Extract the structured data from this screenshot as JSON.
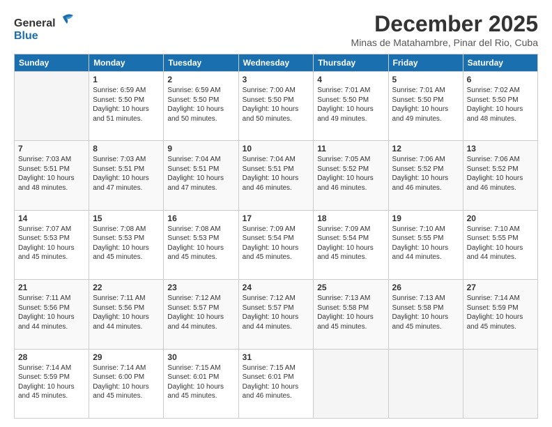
{
  "logo": {
    "line1": "General",
    "line2": "Blue"
  },
  "title": "December 2025",
  "subtitle": "Minas de Matahambre, Pinar del Rio, Cuba",
  "days_header": [
    "Sunday",
    "Monday",
    "Tuesday",
    "Wednesday",
    "Thursday",
    "Friday",
    "Saturday"
  ],
  "weeks": [
    [
      {
        "num": "",
        "info": ""
      },
      {
        "num": "1",
        "info": "Sunrise: 6:59 AM\nSunset: 5:50 PM\nDaylight: 10 hours\nand 51 minutes."
      },
      {
        "num": "2",
        "info": "Sunrise: 6:59 AM\nSunset: 5:50 PM\nDaylight: 10 hours\nand 50 minutes."
      },
      {
        "num": "3",
        "info": "Sunrise: 7:00 AM\nSunset: 5:50 PM\nDaylight: 10 hours\nand 50 minutes."
      },
      {
        "num": "4",
        "info": "Sunrise: 7:01 AM\nSunset: 5:50 PM\nDaylight: 10 hours\nand 49 minutes."
      },
      {
        "num": "5",
        "info": "Sunrise: 7:01 AM\nSunset: 5:50 PM\nDaylight: 10 hours\nand 49 minutes."
      },
      {
        "num": "6",
        "info": "Sunrise: 7:02 AM\nSunset: 5:50 PM\nDaylight: 10 hours\nand 48 minutes."
      }
    ],
    [
      {
        "num": "7",
        "info": "Sunrise: 7:03 AM\nSunset: 5:51 PM\nDaylight: 10 hours\nand 48 minutes."
      },
      {
        "num": "8",
        "info": "Sunrise: 7:03 AM\nSunset: 5:51 PM\nDaylight: 10 hours\nand 47 minutes."
      },
      {
        "num": "9",
        "info": "Sunrise: 7:04 AM\nSunset: 5:51 PM\nDaylight: 10 hours\nand 47 minutes."
      },
      {
        "num": "10",
        "info": "Sunrise: 7:04 AM\nSunset: 5:51 PM\nDaylight: 10 hours\nand 46 minutes."
      },
      {
        "num": "11",
        "info": "Sunrise: 7:05 AM\nSunset: 5:52 PM\nDaylight: 10 hours\nand 46 minutes."
      },
      {
        "num": "12",
        "info": "Sunrise: 7:06 AM\nSunset: 5:52 PM\nDaylight: 10 hours\nand 46 minutes."
      },
      {
        "num": "13",
        "info": "Sunrise: 7:06 AM\nSunset: 5:52 PM\nDaylight: 10 hours\nand 46 minutes."
      }
    ],
    [
      {
        "num": "14",
        "info": "Sunrise: 7:07 AM\nSunset: 5:53 PM\nDaylight: 10 hours\nand 45 minutes."
      },
      {
        "num": "15",
        "info": "Sunrise: 7:08 AM\nSunset: 5:53 PM\nDaylight: 10 hours\nand 45 minutes."
      },
      {
        "num": "16",
        "info": "Sunrise: 7:08 AM\nSunset: 5:53 PM\nDaylight: 10 hours\nand 45 minutes."
      },
      {
        "num": "17",
        "info": "Sunrise: 7:09 AM\nSunset: 5:54 PM\nDaylight: 10 hours\nand 45 minutes."
      },
      {
        "num": "18",
        "info": "Sunrise: 7:09 AM\nSunset: 5:54 PM\nDaylight: 10 hours\nand 45 minutes."
      },
      {
        "num": "19",
        "info": "Sunrise: 7:10 AM\nSunset: 5:55 PM\nDaylight: 10 hours\nand 44 minutes."
      },
      {
        "num": "20",
        "info": "Sunrise: 7:10 AM\nSunset: 5:55 PM\nDaylight: 10 hours\nand 44 minutes."
      }
    ],
    [
      {
        "num": "21",
        "info": "Sunrise: 7:11 AM\nSunset: 5:56 PM\nDaylight: 10 hours\nand 44 minutes."
      },
      {
        "num": "22",
        "info": "Sunrise: 7:11 AM\nSunset: 5:56 PM\nDaylight: 10 hours\nand 44 minutes."
      },
      {
        "num": "23",
        "info": "Sunrise: 7:12 AM\nSunset: 5:57 PM\nDaylight: 10 hours\nand 44 minutes."
      },
      {
        "num": "24",
        "info": "Sunrise: 7:12 AM\nSunset: 5:57 PM\nDaylight: 10 hours\nand 44 minutes."
      },
      {
        "num": "25",
        "info": "Sunrise: 7:13 AM\nSunset: 5:58 PM\nDaylight: 10 hours\nand 45 minutes."
      },
      {
        "num": "26",
        "info": "Sunrise: 7:13 AM\nSunset: 5:58 PM\nDaylight: 10 hours\nand 45 minutes."
      },
      {
        "num": "27",
        "info": "Sunrise: 7:14 AM\nSunset: 5:59 PM\nDaylight: 10 hours\nand 45 minutes."
      }
    ],
    [
      {
        "num": "28",
        "info": "Sunrise: 7:14 AM\nSunset: 5:59 PM\nDaylight: 10 hours\nand 45 minutes."
      },
      {
        "num": "29",
        "info": "Sunrise: 7:14 AM\nSunset: 6:00 PM\nDaylight: 10 hours\nand 45 minutes."
      },
      {
        "num": "30",
        "info": "Sunrise: 7:15 AM\nSunset: 6:01 PM\nDaylight: 10 hours\nand 45 minutes."
      },
      {
        "num": "31",
        "info": "Sunrise: 7:15 AM\nSunset: 6:01 PM\nDaylight: 10 hours\nand 46 minutes."
      },
      {
        "num": "",
        "info": ""
      },
      {
        "num": "",
        "info": ""
      },
      {
        "num": "",
        "info": ""
      }
    ]
  ]
}
